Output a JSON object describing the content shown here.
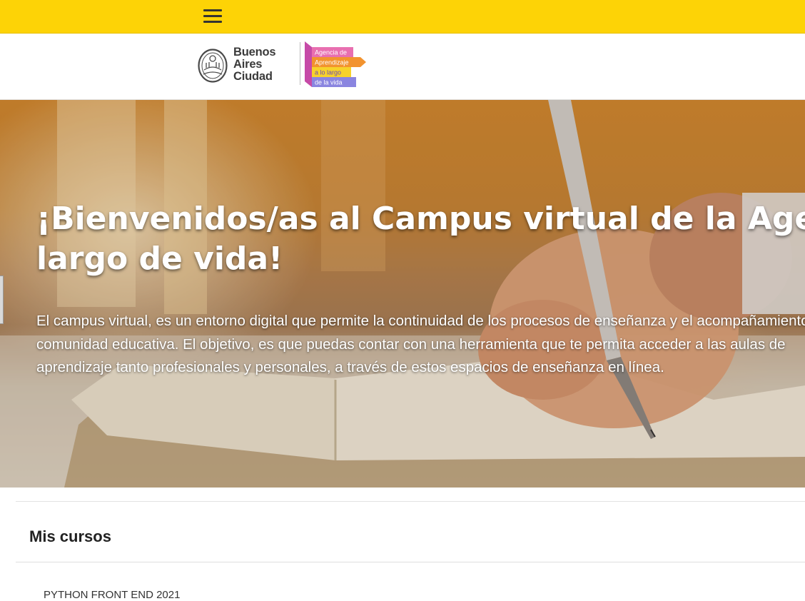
{
  "header": {
    "menu_icon": "hamburger-icon",
    "color": "#fdd306"
  },
  "logos": {
    "ciudad": [
      "Buenos",
      "Aires",
      "Ciudad"
    ],
    "agencia": [
      "Agencia de",
      "Aprendizaje",
      "a lo largo",
      "de la vida"
    ]
  },
  "hero": {
    "title_line1": "¡Bienvenidos/as al Campus virtual de la Agencia de Aprendizaje a lo",
    "title_line2": "largo de vida!",
    "desc_line1": "El campus virtual, es un entorno digital que permite la continuidad de los procesos de enseñanza y el acompañamiento de la",
    "desc_line2": "comunidad educativa. El objetivo, es que puedas contar con una herramienta que te permita acceder a las aulas de",
    "desc_line3": "aprendizaje tanto profesionales y personales, a través de estos espacios de enseñanza en línea."
  },
  "courses": {
    "title": "Mis cursos",
    "items": [
      "PYTHON FRONT END 2021"
    ]
  }
}
